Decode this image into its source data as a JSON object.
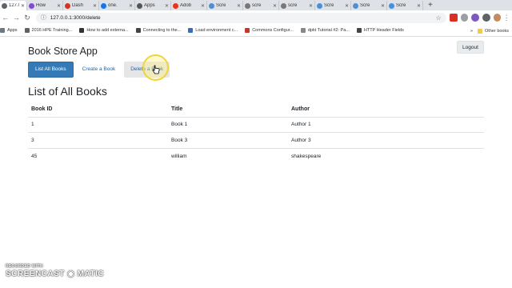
{
  "browser": {
    "tabs": [
      {
        "label": "127.0",
        "color": "#5f6368",
        "active": true
      },
      {
        "label": "How",
        "color": "#7b4fc9"
      },
      {
        "label": "Dash",
        "color": "#d93025"
      },
      {
        "label": "one.",
        "color": "#1a73e8"
      },
      {
        "label": "Apps",
        "color": "#555555"
      },
      {
        "label": "Adob",
        "color": "#e8341c"
      },
      {
        "label": "Scre",
        "color": "#4a90d9"
      },
      {
        "label": "scre",
        "color": "#777777"
      },
      {
        "label": "scre",
        "color": "#777777"
      },
      {
        "label": "Scre",
        "color": "#4a90d9"
      },
      {
        "label": "Scre",
        "color": "#4a90d9"
      },
      {
        "label": "Scre",
        "color": "#4a90d9"
      }
    ],
    "url": "127.0.0.1:3000/delete",
    "bookmarks": [
      {
        "label": "Apps",
        "color": "#6d7885"
      },
      {
        "label": "2016 HPE Training...",
        "color": "#5f6368"
      },
      {
        "label": "How to add externa...",
        "color": "#333333"
      },
      {
        "label": "Connecting to the...",
        "color": "#444444"
      },
      {
        "label": "Load environment c...",
        "color": "#3b6db3"
      },
      {
        "label": "Commons Configur...",
        "color": "#c0392b"
      },
      {
        "label": "dpkt Tutorial #2: Pa...",
        "color": "#888888"
      },
      {
        "label": "HTTP Header Fields",
        "color": "#444444"
      }
    ],
    "bookmarks_more": "»",
    "other_bookmarks": "Other books"
  },
  "app": {
    "title": "Book Store App",
    "logout": "Logout",
    "nav": {
      "list_all": "List All Books",
      "create": "Create a Book",
      "delete": "Delete a Book"
    },
    "list_title": "List of All Books",
    "columns": [
      "Book ID",
      "Title",
      "Author"
    ],
    "rows": [
      [
        "1",
        "Book 1",
        "Author 1"
      ],
      [
        "3",
        "Book 3",
        "Author 3"
      ],
      [
        "45",
        "william",
        "shakespeare"
      ]
    ]
  },
  "watermark": {
    "line1": "RECORDED WITH",
    "line2": "SCREENCAST ◉ MATIC"
  }
}
